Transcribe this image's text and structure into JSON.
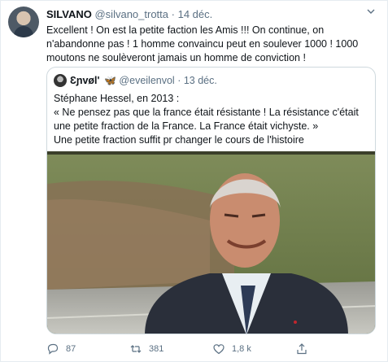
{
  "tweet": {
    "author_name": "SILVANO",
    "author_handle": "@silvano_trotta",
    "separator": "·",
    "date": "14 déc.",
    "text": "Excellent ! On est la petite faction les Amis !!! On continue, on n'abandonne pas ! 1 homme convaincu peut en soulever 1000 ! 1000 moutons ne soulèveront jamais un homme de conviction !"
  },
  "quoted": {
    "author_name": "Ɛɲvøl'",
    "author_emoji": "🦋",
    "author_handle": "@eveilenvol",
    "separator": "·",
    "date": "13 déc.",
    "line1": "Stéphane Hessel, en 2013 :",
    "line2": "« Ne pensez pas que la france était résistante ! La résistance c'était une petite fraction de la France. La France était vichyste. »",
    "line3": "Une petite fraction suffit pr changer le cours de l'histoire"
  },
  "actions": {
    "replies": "87",
    "retweets": "381",
    "likes": "1,8 k"
  },
  "colors": {
    "muted": "#5b7083",
    "border": "#cfd9de",
    "accent": "#1d9bf0"
  },
  "icons": [
    "chevron-down-icon",
    "reply-icon",
    "retweet-icon",
    "like-icon",
    "share-icon"
  ]
}
